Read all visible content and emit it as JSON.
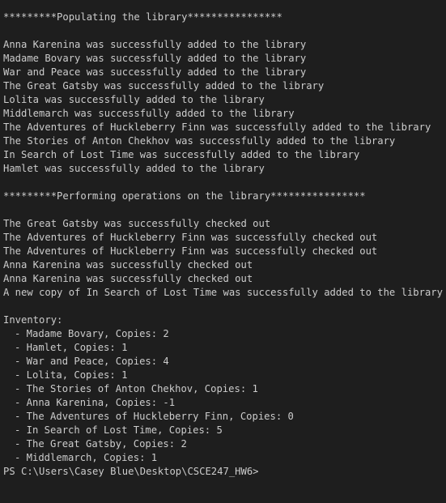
{
  "theme": {
    "background": "#1e1e1e",
    "text": "#cccccc"
  },
  "section_populate": {
    "header": "*********Populating the library****************",
    "lines": [
      "Anna Karenina was successfully added to the library",
      "Madame Bovary was successfully added to the library",
      "War and Peace was successfully added to the library",
      "The Great Gatsby was successfully added to the library",
      "Lolita was successfully added to the library",
      "Middlemarch was successfully added to the library",
      "The Adventures of Huckleberry Finn was successfully added to the library",
      "The Stories of Anton Chekhov was successfully added to the library",
      "In Search of Lost Time was successfully added to the library",
      "Hamlet was successfully added to the library"
    ]
  },
  "section_operations": {
    "header": "*********Performing operations on the library****************",
    "lines": [
      "The Great Gatsby was successfully checked out",
      "The Adventures of Huckleberry Finn was successfully checked out",
      "The Adventures of Huckleberry Finn was successfully checked out",
      "Anna Karenina was successfully checked out",
      "Anna Karenina was successfully checked out",
      "A new copy of In Search of Lost Time was successfully added to the library"
    ]
  },
  "inventory": {
    "title": "Inventory:",
    "items": [
      "- Madame Bovary, Copies: 2",
      "- Hamlet, Copies: 1",
      "- War and Peace, Copies: 4",
      "- Lolita, Copies: 1",
      "- The Stories of Anton Chekhov, Copies: 1",
      "- Anna Karenina, Copies: -1",
      "- The Adventures of Huckleberry Finn, Copies: 0",
      "- In Search of Lost Time, Copies: 5",
      "- The Great Gatsby, Copies: 2",
      "- Middlemarch, Copies: 1"
    ]
  },
  "prompt": "PS C:\\Users\\Casey Blue\\Desktop\\CSCE247_HW6>"
}
